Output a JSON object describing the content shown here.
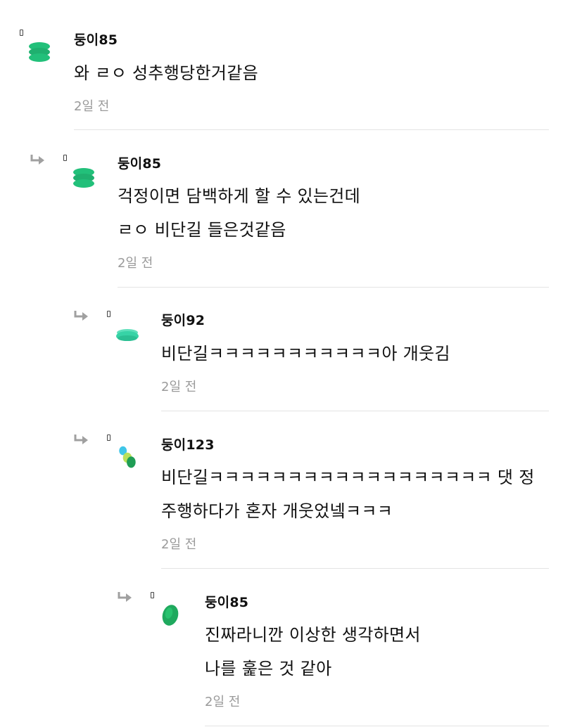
{
  "comments": [
    {
      "username": "둥이85",
      "avatar_icon": "green-stack-icon",
      "lines": [
        "와 ㄹㅇ 성추행당한거같음"
      ],
      "time": "2일 전"
    },
    {
      "username": "둥이85",
      "avatar_icon": "green-stack-icon",
      "lines": [
        "걱정이면 담백하게 할 수 있는건데",
        "ㄹㅇ 비단길 들은것같음"
      ],
      "time": "2일 전"
    },
    {
      "username": "둥이92",
      "avatar_icon": "teal-disc-icon",
      "lines": [
        "비단길ㅋㅋㅋㅋㅋㅋㅋㅋㅋㅋㅋ아 개웃김"
      ],
      "time": "2일 전"
    },
    {
      "username": "둥이123",
      "avatar_icon": "multicolor-circles-icon",
      "lines": [
        "비단길ㅋㅋㅋㅋㅋㅋㅋㅋㅋㅋㅋㅋㅋㅋㅋㅋㅋㅋ 댓 정",
        "주행하다가 혼자 개웃었넼ㅋㅋㅋ"
      ],
      "time": "2일 전"
    },
    {
      "username": "둥이85",
      "avatar_icon": "green-oval-icon",
      "lines": [
        "진짜라니깐 이상한 생각하면서",
        "나를 훑은 것 같아"
      ],
      "time": "2일 전"
    }
  ],
  "colors": {
    "green": "#22c07a",
    "teal": "#37d3a6",
    "timestamp": "#9a9a9a",
    "divider": "#e4e4e4"
  }
}
